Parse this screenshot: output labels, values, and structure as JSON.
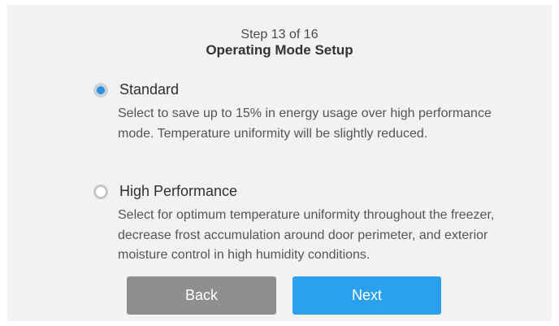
{
  "header": {
    "step": "Step 13 of 16",
    "title": "Operating Mode Setup"
  },
  "options": [
    {
      "label": "Standard",
      "description": "Select to save up to 15% in energy usage over high performance mode. Temperature uniformity will be slightly reduced.",
      "selected": true
    },
    {
      "label": "High Performance",
      "description": "Select for optimum temperature uniformity throughout the freezer, decrease frost accumulation around door perimeter, and exterior moisture control in high humidity conditions.",
      "selected": false
    }
  ],
  "buttons": {
    "back_label": "Back",
    "next_label": "Next"
  },
  "colors": {
    "accent": "#2ba0ee",
    "back_button": "#8f8f8f",
    "background": "#f2f2f2"
  }
}
